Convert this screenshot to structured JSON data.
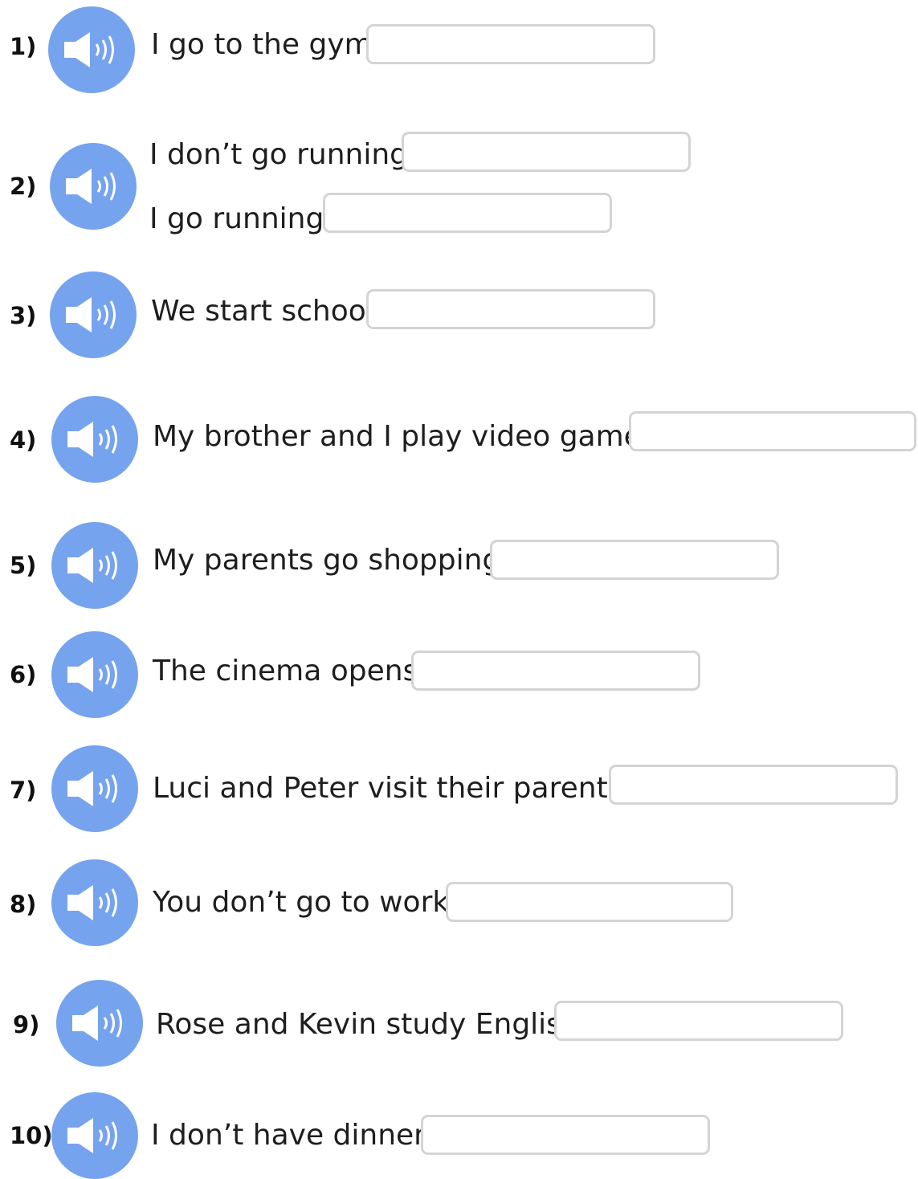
{
  "colors": {
    "speaker_button": "#76a3ee",
    "icon": "#ffffff",
    "input_border": "#d4d4d4"
  },
  "icons": {
    "audio_button": "speaker-icon"
  },
  "items": [
    {
      "number": "1)",
      "lines": [
        {
          "text": "I go to the gym",
          "answer": ""
        }
      ]
    },
    {
      "number": "2)",
      "lines": [
        {
          "text": "I don’t go running",
          "answer": ""
        },
        {
          "text": "I go running",
          "answer": ""
        }
      ]
    },
    {
      "number": "3)",
      "lines": [
        {
          "text": "We start school",
          "answer": ""
        }
      ]
    },
    {
      "number": "4)",
      "lines": [
        {
          "text": "My brother and I play video games",
          "answer": ""
        }
      ]
    },
    {
      "number": "5)",
      "lines": [
        {
          "text": "My parents go shopping",
          "answer": ""
        }
      ]
    },
    {
      "number": "6)",
      "lines": [
        {
          "text": "The cinema opens",
          "answer": ""
        }
      ]
    },
    {
      "number": "7)",
      "lines": [
        {
          "text": "Luci and Peter visit their parents",
          "answer": ""
        }
      ]
    },
    {
      "number": "8)",
      "lines": [
        {
          "text": "You don’t go to work",
          "answer": ""
        }
      ]
    },
    {
      "number": "9)",
      "lines": [
        {
          "text": "Rose and Kevin study English",
          "answer": ""
        }
      ]
    },
    {
      "number": "10)",
      "lines": [
        {
          "text": "I don’t have dinner",
          "answer": ""
        }
      ]
    }
  ]
}
